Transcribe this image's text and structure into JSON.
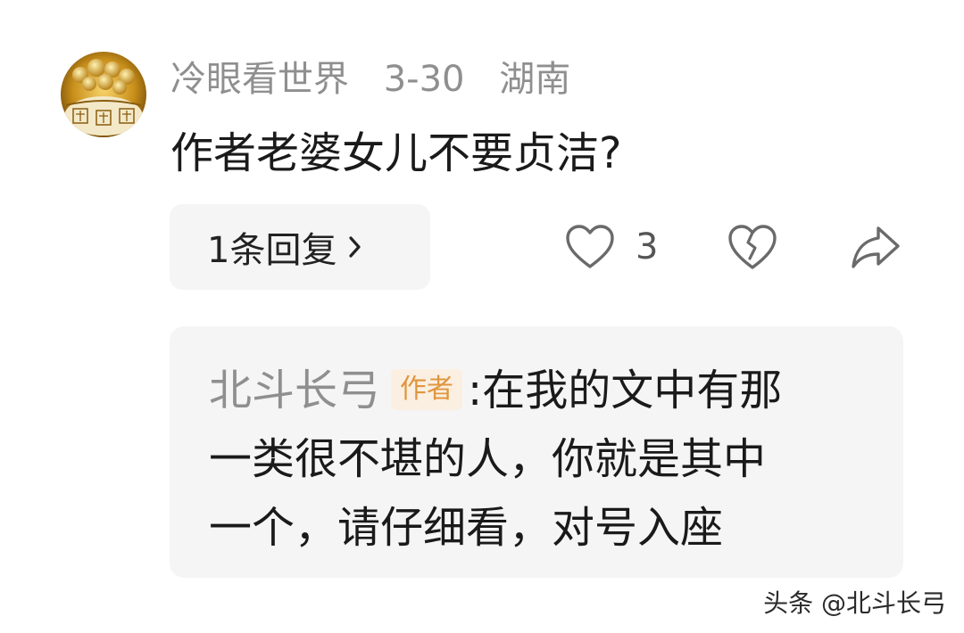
{
  "comment": {
    "username": "冷眼看世界",
    "date": "3-30",
    "location": "湖南",
    "text": "作者老婆女儿不要贞洁?",
    "avatar_icon": "gold-treasure-pot-avatar"
  },
  "actions": {
    "reply_label": "1条回复",
    "like_count": "3",
    "like_icon": "heart-outline-icon",
    "dislike_icon": "broken-heart-icon",
    "share_icon": "share-arrow-icon"
  },
  "reply": {
    "author": "北斗长弓",
    "badge": "作者",
    "colon": ":",
    "lines": [
      "在我的文中有那",
      "一类很不堪的人，你就是其中",
      "一个，请仔细看，对号入座"
    ]
  },
  "watermark": "头条 @北斗长弓",
  "colors": {
    "meta_gray": "#8f8f8f",
    "badge_bg": "#fbefe2",
    "badge_text": "#e0963d",
    "card_bg": "#f5f5f5"
  }
}
